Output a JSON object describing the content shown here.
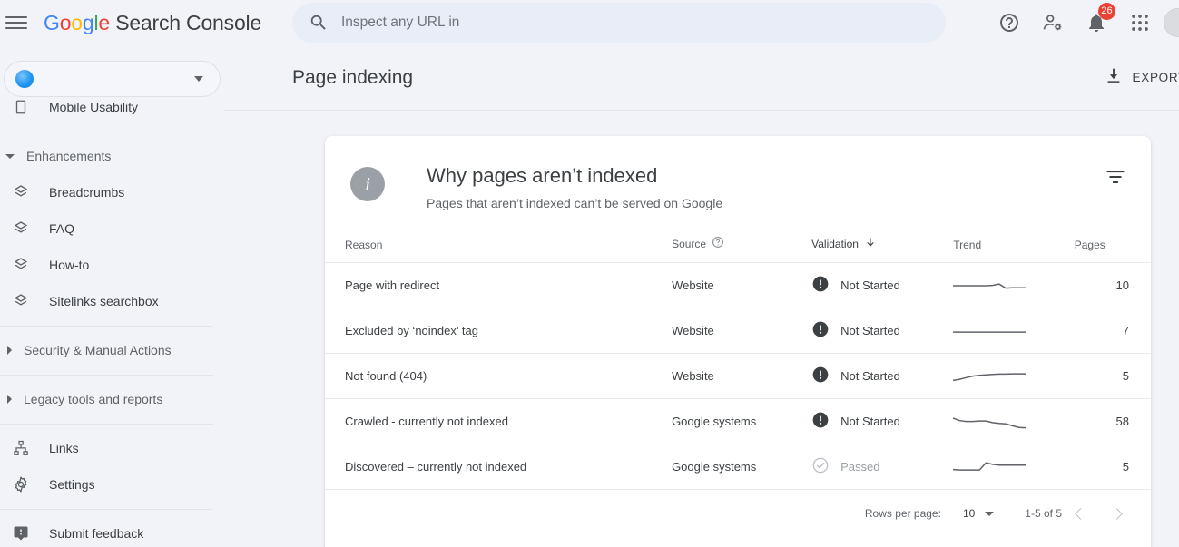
{
  "header": {
    "menu_icon": "hamburger-menu-icon",
    "brand": {
      "g1": "G",
      "o1": "o",
      "o2": "o",
      "g2": "g",
      "l1": "l",
      "e1": "e",
      "rest": " Search Console"
    },
    "search": {
      "icon": "search-icon",
      "placeholder": "Inspect any URL in",
      "value": ""
    },
    "icons": [
      {
        "name": "help-icon",
        "label": "Help"
      },
      {
        "name": "account-settings-icon",
        "label": "Account settings"
      },
      {
        "name": "notifications-bell-icon",
        "label": "Notifications",
        "badge": "26"
      },
      {
        "name": "google-apps-grid-icon",
        "label": "Google apps"
      },
      {
        "name": "avatar",
        "label": "Account"
      }
    ]
  },
  "sidebar": {
    "property_selector": {
      "name": "",
      "icon": "property-globe-icon",
      "caret": "chevron-down-icon"
    },
    "items": [
      {
        "label": "Mobile Usability",
        "icon": "mobile-device-icon",
        "type": "item",
        "clipped": true
      },
      {
        "label": "Enhancements",
        "icon": "chevron-down-icon",
        "type": "group",
        "expanded": true
      },
      {
        "label": "Breadcrumbs",
        "icon": "layers-diamond-icon",
        "type": "item"
      },
      {
        "label": "FAQ",
        "icon": "layers-diamond-icon",
        "type": "item"
      },
      {
        "label": "How-to",
        "icon": "layers-diamond-icon",
        "type": "item"
      },
      {
        "label": "Sitelinks searchbox",
        "icon": "layers-diamond-icon",
        "type": "item"
      },
      {
        "label": "Security & Manual Actions",
        "icon": "chevron-right-icon",
        "type": "group",
        "expanded": false
      },
      {
        "label": "Legacy tools and reports",
        "icon": "chevron-right-icon",
        "type": "group",
        "expanded": false
      },
      {
        "label": "Links",
        "icon": "sitemap-links-icon",
        "type": "item"
      },
      {
        "label": "Settings",
        "icon": "gear-icon",
        "type": "item"
      },
      {
        "label": "Submit feedback",
        "icon": "feedback-icon",
        "type": "item"
      }
    ]
  },
  "main": {
    "page_title": "Page indexing",
    "export_button": {
      "label": "EXPORT",
      "icon": "download-icon"
    },
    "card": {
      "info_icon": "info-circle-icon",
      "title": "Why pages aren’t indexed",
      "subtitle": "Pages that aren’t indexed can’t be served on Google",
      "filter_icon": "filter-funnel-icon",
      "columns": [
        {
          "key": "reason",
          "label": "Reason",
          "icon": null,
          "sorted": false
        },
        {
          "key": "source",
          "label": "Source",
          "icon": "help-circle-icon",
          "sorted": false
        },
        {
          "key": "validation",
          "label": "Validation",
          "icon": "sort-arrow-down-icon",
          "sorted": true
        },
        {
          "key": "trend",
          "label": "Trend",
          "icon": null,
          "sorted": false
        },
        {
          "key": "pages",
          "label": "Pages",
          "icon": null,
          "sorted": false
        }
      ],
      "rows": [
        {
          "reason": "Page with redirect",
          "source": "Website",
          "validation": "Not Started",
          "validation_state": "not-started",
          "pages": "10",
          "trend": [
            50,
            50,
            50,
            50,
            50,
            50,
            52,
            58,
            38,
            40,
            40,
            40
          ]
        },
        {
          "reason": "Excluded by ‘noindex’ tag",
          "source": "Website",
          "validation": "Not Started",
          "validation_state": "not-started",
          "pages": "7",
          "trend": [
            45,
            45,
            45,
            45,
            45,
            45,
            45,
            45,
            45,
            45,
            45,
            45
          ]
        },
        {
          "reason": "Not found (404)",
          "source": "Website",
          "validation": "Not Started",
          "validation_state": "not-started",
          "pages": "5",
          "trend": [
            30,
            36,
            44,
            52,
            56,
            58,
            60,
            62,
            62,
            63,
            63,
            63
          ]
        },
        {
          "reason": "Crawled - currently not indexed",
          "source": "Google systems",
          "validation": "Not Started",
          "validation_state": "not-started",
          "pages": "58",
          "trend": [
            68,
            56,
            52,
            52,
            54,
            54,
            46,
            42,
            40,
            30,
            22,
            20
          ]
        },
        {
          "reason": "Discovered – currently not indexed",
          "source": "Google systems",
          "validation": "Passed",
          "validation_state": "passed",
          "pages": "5",
          "trend": [
            38,
            36,
            36,
            36,
            36,
            72,
            64,
            60,
            60,
            60,
            60,
            60
          ]
        }
      ],
      "footer": {
        "rows_per_page_label": "Rows per page:",
        "rows_per_page_value": "10",
        "rows_per_page_caret": "chevron-down-icon",
        "range": "1-5 of 5",
        "prev_icon": "chevron-left-icon",
        "next_icon": "chevron-right-icon"
      }
    }
  },
  "colors": {
    "page_bg": "#f1f3f9",
    "card_bg": "#ffffff",
    "text_primary": "#3c4043",
    "text_secondary": "#5f6368",
    "badge_red": "#ea4335",
    "google_blue": "#4285f4",
    "google_red": "#ea4335",
    "google_yellow": "#fbbc05",
    "google_green": "#34a853",
    "status_not_started": "#3c4043",
    "status_passed": "#9aa0a6"
  }
}
